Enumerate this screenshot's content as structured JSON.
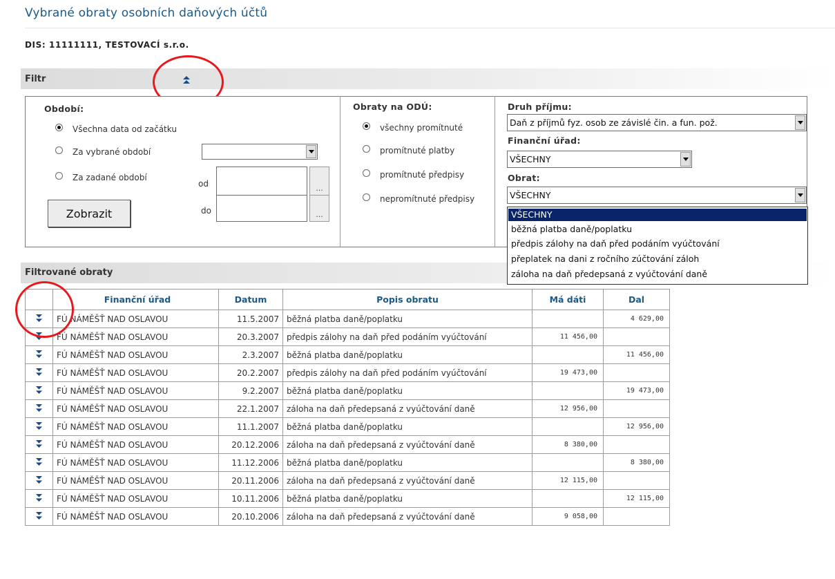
{
  "page": {
    "title": "Vybrané obraty osobních daňových účtů",
    "dis_label": "DIS: 11111111, TESTOVACÍ s.r.o."
  },
  "filter": {
    "label": "Filtr",
    "toggle_icon": "double-chevron-up-icon",
    "period": {
      "label": "Období:",
      "options": [
        {
          "label": "Všechna data od začátku",
          "checked": true
        },
        {
          "label": "Za vybrané období",
          "checked": false
        },
        {
          "label": "Za zadané období",
          "checked": false
        }
      ],
      "from_label": "od",
      "to_label": "do",
      "dots_label": "...",
      "show_button": "Zobrazit",
      "select_value": ""
    },
    "odu": {
      "label": "Obraty na ODÚ:",
      "options": [
        {
          "label": "všechny promítnuté",
          "checked": true
        },
        {
          "label": "promítnuté platby",
          "checked": false
        },
        {
          "label": "promítnuté předpisy",
          "checked": false
        },
        {
          "label": "nepromítnuté předpisy",
          "checked": false
        }
      ]
    },
    "income_type": {
      "label": "Druh příjmu:",
      "value": "Daň z příjmů fyz. osob ze závislé čin. a fun. pož."
    },
    "office": {
      "label": "Finanční úřad:",
      "value": "VŠECHNY"
    },
    "turnover": {
      "label": "Obrat:",
      "value": "VŠECHNY",
      "options": [
        "VŠECHNY",
        "běžná platba daně/poplatku",
        "předpis zálohy na daň před podáním vyúčtování",
        "přeplatek na dani z ročního zúčtování záloh",
        "záloha na daň předepsaná z vyúčtování daně"
      ]
    }
  },
  "results": {
    "label": "Filtrované obraty",
    "row_icon": "double-chevron-down-icon",
    "columns": [
      "",
      "Finanční úřad",
      "Datum",
      "Popis obratu",
      "Má dáti",
      "Dal"
    ],
    "rows": [
      {
        "office": "FÚ NÁMĚŠŤ NAD OSLAVOU",
        "date": "11.5.2007",
        "desc": "běžná platba daně/poplatku",
        "debit": "",
        "credit": "4 629,00"
      },
      {
        "office": "FÚ NÁMĚŠŤ NAD OSLAVOU",
        "date": "20.3.2007",
        "desc": "předpis zálohy na daň před podáním vyúčtování",
        "debit": "11 456,00",
        "credit": ""
      },
      {
        "office": "FÚ NÁMĚŠŤ NAD OSLAVOU",
        "date": "2.3.2007",
        "desc": "běžná platba daně/poplatku",
        "debit": "",
        "credit": "11 456,00"
      },
      {
        "office": "FÚ NÁMĚŠŤ NAD OSLAVOU",
        "date": "20.2.2007",
        "desc": "předpis zálohy na daň před podáním vyúčtování",
        "debit": "19 473,00",
        "credit": ""
      },
      {
        "office": "FÚ NÁMĚŠŤ NAD OSLAVOU",
        "date": "9.2.2007",
        "desc": "běžná platba daně/poplatku",
        "debit": "",
        "credit": "19 473,00"
      },
      {
        "office": "FÚ NÁMĚŠŤ NAD OSLAVOU",
        "date": "22.1.2007",
        "desc": "záloha na daň předepsaná z vyúčtování daně",
        "debit": "12 956,00",
        "credit": ""
      },
      {
        "office": "FÚ NÁMĚŠŤ NAD OSLAVOU",
        "date": "11.1.2007",
        "desc": "běžná platba daně/poplatku",
        "debit": "",
        "credit": "12 956,00"
      },
      {
        "office": "FÚ NÁMĚŠŤ NAD OSLAVOU",
        "date": "20.12.2006",
        "desc": "záloha na daň předepsaná z vyúčtování daně",
        "debit": "8 380,00",
        "credit": ""
      },
      {
        "office": "FÚ NÁMĚŠŤ NAD OSLAVOU",
        "date": "11.12.2006",
        "desc": "běžná platba daně/poplatku",
        "debit": "",
        "credit": "8 380,00"
      },
      {
        "office": "FÚ NÁMĚŠŤ NAD OSLAVOU",
        "date": "20.11.2006",
        "desc": "záloha na daň předepsaná z vyúčtování daně",
        "debit": "12 115,00",
        "credit": ""
      },
      {
        "office": "FÚ NÁMĚŠŤ NAD OSLAVOU",
        "date": "10.11.2006",
        "desc": "běžná platba daně/poplatku",
        "debit": "",
        "credit": "12 115,00"
      },
      {
        "office": "FÚ NÁMĚŠŤ NAD OSLAVOU",
        "date": "20.10.2006",
        "desc": "záloha na daň předepsaná z vyúčtování daně",
        "debit": "9 058,00",
        "credit": ""
      }
    ]
  },
  "colors": {
    "accent": "#1a5a8a",
    "highlight_circle": "#e8191c",
    "selection": "#0a246a"
  }
}
